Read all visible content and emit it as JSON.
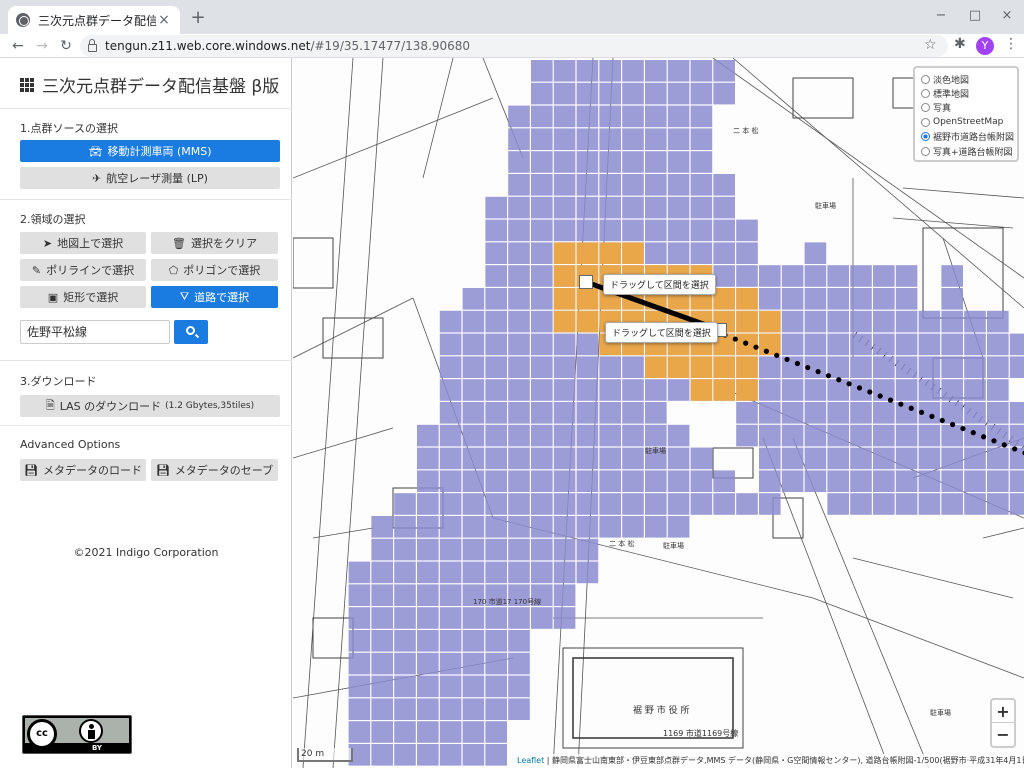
{
  "browser": {
    "tab_title": "三次元点群データ配信基盤 β版",
    "tab_close": "×",
    "new_tab": "+",
    "url_host": "tengun.z11.web.core.windows.net",
    "url_path": "/#19/35.17477/138.90680",
    "profile_initial": "Y",
    "window_buttons": [
      "−",
      "□",
      "×"
    ]
  },
  "sidebar": {
    "title": "三次元点群データ配信基盤 β版",
    "section1": {
      "label": "1.点群ソースの選択",
      "mms_label": "移動計測車両 (MMS)",
      "lp_label": "航空レーザ測量 (LP)"
    },
    "section2": {
      "label": "2.領域の選択",
      "select_on_map": "地図上で選択",
      "clear_selection": "選択をクリア",
      "polyline_select": "ポリラインで選択",
      "polygon_select": "ポリゴンで選択",
      "rect_select": "矩形で選択",
      "road_select": "道路で選択",
      "road_name_value": "佐野平松線"
    },
    "section3": {
      "label": "3.ダウンロード",
      "download_label": "LAS のダウンロード",
      "download_info": "(1.2 Gbytes,35tiles)"
    },
    "advanced": {
      "label": "Advanced Options",
      "load_meta": "メタデータのロード",
      "save_meta": "メタデータのセーブ"
    },
    "copyright": "©2021 Indigo Corporation",
    "license_badge": {
      "cc": "cc",
      "by": "BY"
    }
  },
  "map": {
    "layers": [
      {
        "label": "淡色地図",
        "selected": false
      },
      {
        "label": "標準地図",
        "selected": false
      },
      {
        "label": "写真",
        "selected": false
      },
      {
        "label": "OpenStreetMap",
        "selected": false
      },
      {
        "label": "裾野市道路台帳附図",
        "selected": true
      },
      {
        "label": "写真+道路台帳附図",
        "selected": false
      }
    ],
    "zoom_in": "+",
    "zoom_out": "−",
    "scale_label": "20 m",
    "attribution_link": "Leaflet",
    "attribution_text": "| 静岡県富士山南東部・伊豆東部点群データ,MMS データ(静岡県・G空間情報センター), 道路台帳附図-1/500(裾野市·平成31年4月1日時点)",
    "tooltip_1": "ドラッグして区間を選択",
    "tooltip_2": "ドラッグして区間を選択",
    "labels": {
      "nihonmatsu_1": "二 本 松",
      "nihonmatsu_2": "二 本 松",
      "city_hall": "裾 野 市 役 所",
      "road_1169": "1169 市道1169号線",
      "road_170": "170 市道17 170号線",
      "chushajo_1": "駐車場",
      "chushajo_2": "駐車場",
      "chushajo_3": "駐車場",
      "chushajo_4": "駐車場"
    },
    "colors": {
      "tile_purple": "#8b8bd0",
      "tile_orange": "#f2a93b",
      "accent_blue": "#1a7be0"
    }
  }
}
